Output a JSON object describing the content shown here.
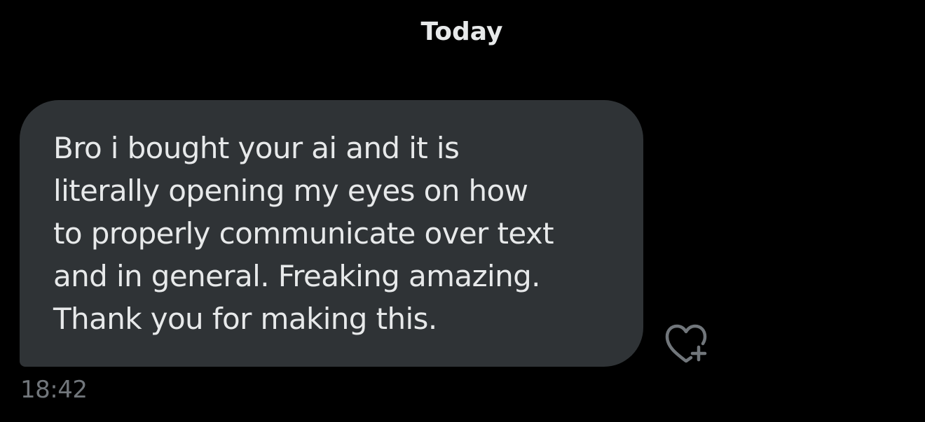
{
  "conversation": {
    "date_separator": "Today",
    "message": {
      "text": "Bro i bought your ai and it is\nliterally opening my eyes on how\nto properly communicate over text\nand in general. Freaking amazing.\nThank you for making this.",
      "timestamp": "18:42",
      "react_icon": "heart-plus-icon"
    }
  },
  "colors": {
    "background": "#000000",
    "bubble": "#2f3336",
    "text": "#e7e9ea",
    "muted": "#71767b"
  }
}
